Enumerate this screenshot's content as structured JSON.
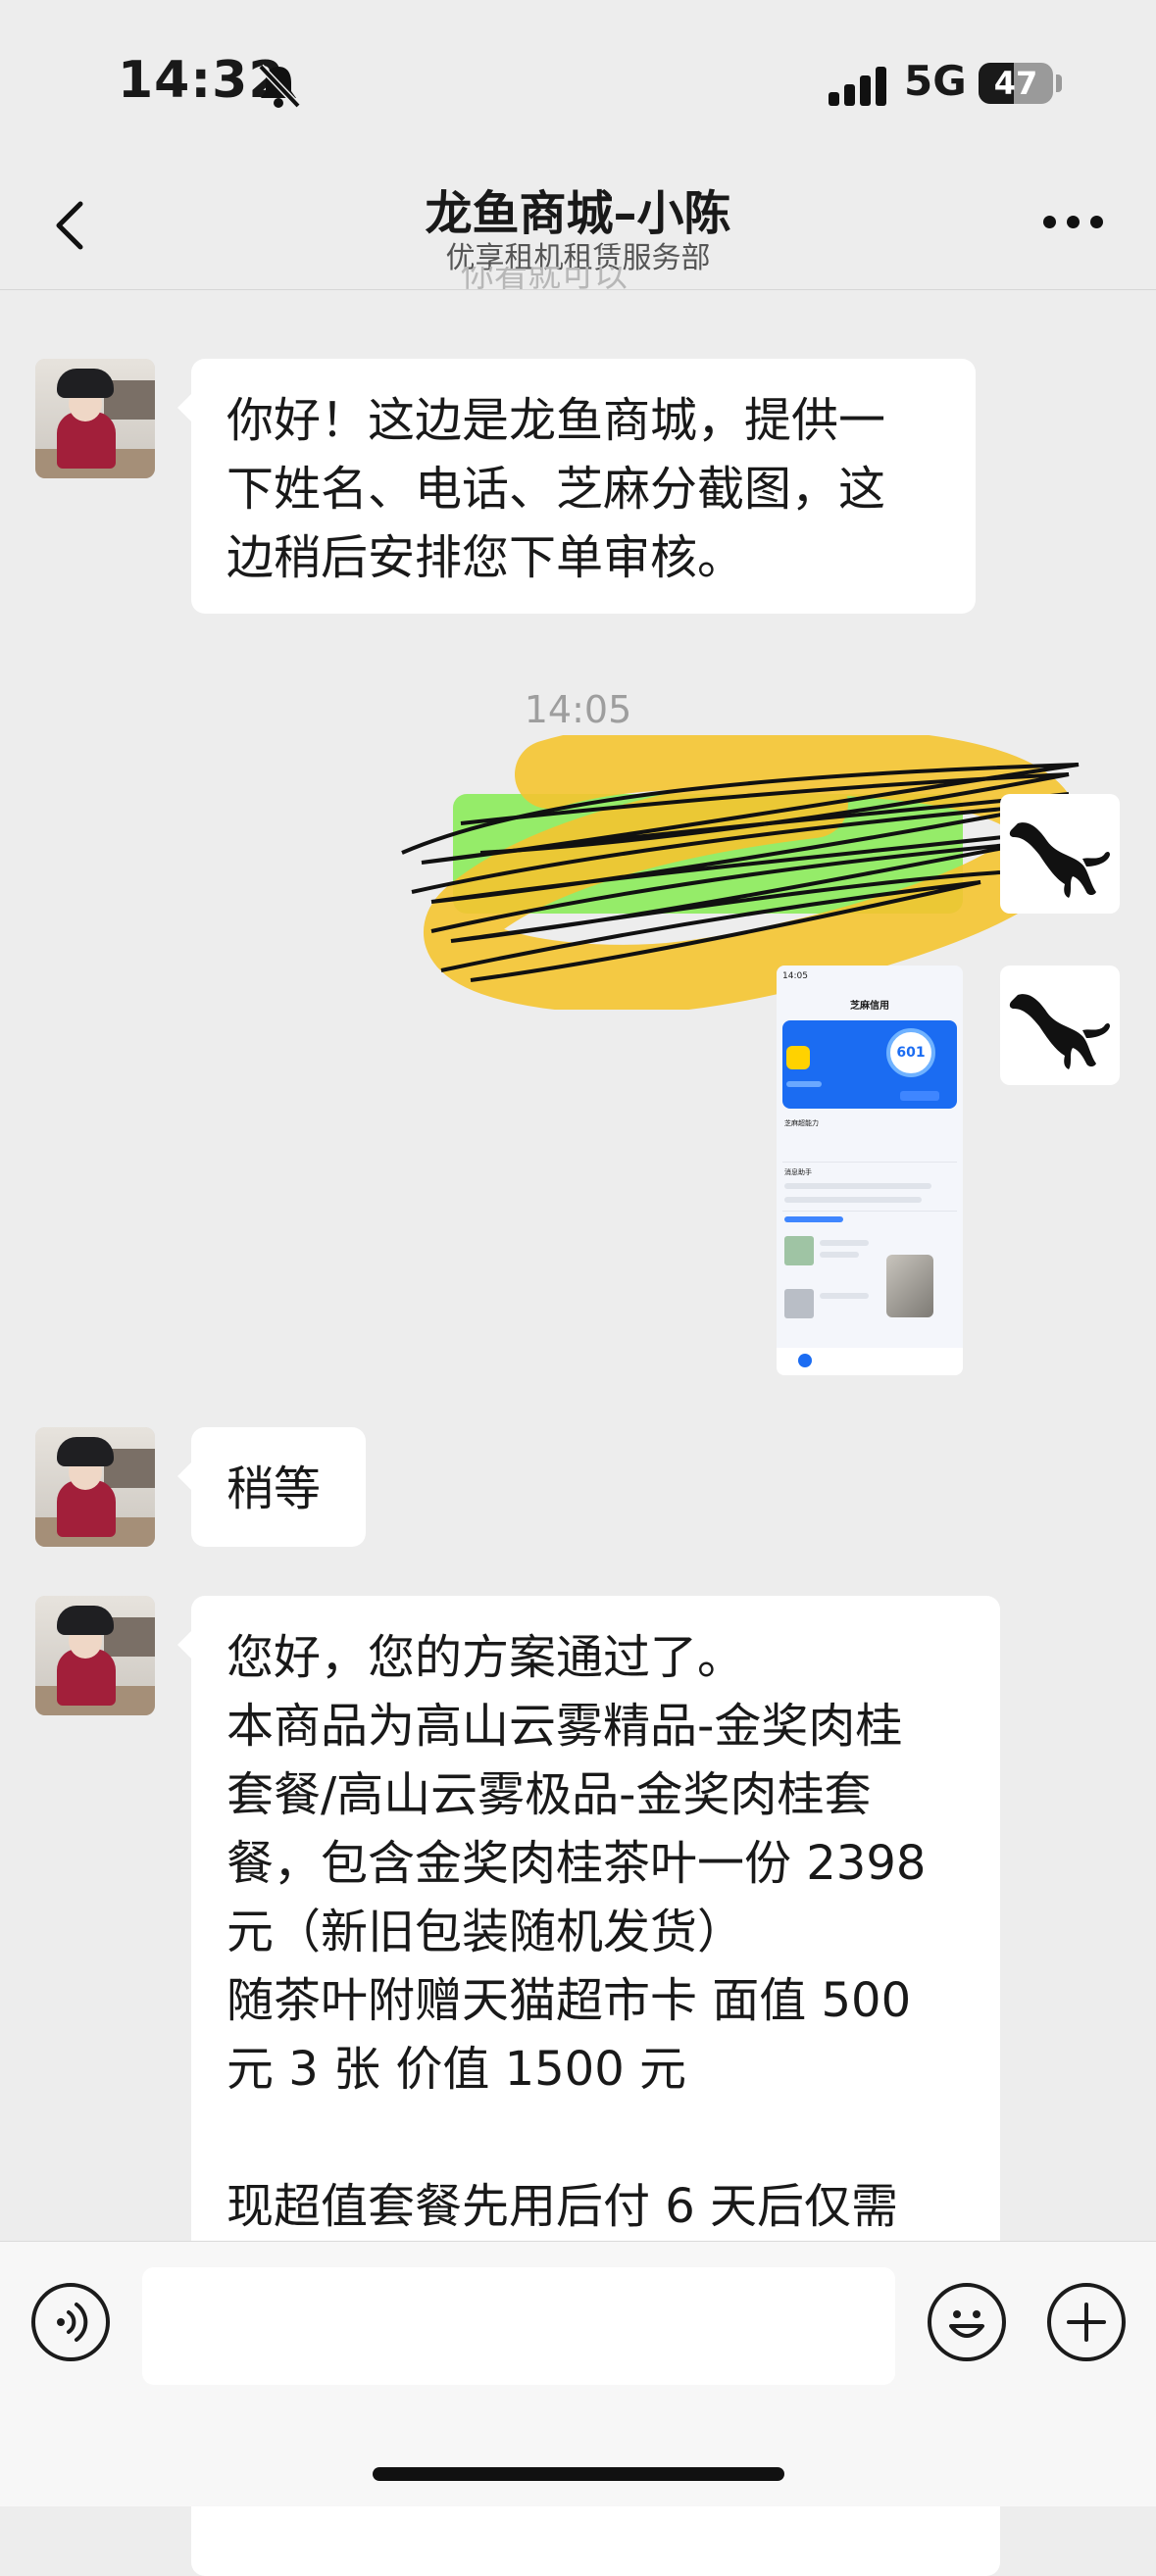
{
  "status_bar": {
    "time": "14:32",
    "network": "5G",
    "battery": "47",
    "battery_level": 0.47
  },
  "nav": {
    "title": "龙鱼商城–小陈",
    "subtitle": "优享租机租赁服务部"
  },
  "messages": {
    "top_cut": "你看就可以",
    "m1": [
      "你好！这边是龙鱼商城，提供一",
      "下姓名、电话、芝麻分截图，这",
      "边稍后安排您下单审核。"
    ],
    "timestamp": "14:05",
    "m2": "稍等",
    "m3": [
      "您好，您的方案通过了。",
      "本商品为高山云雾精品-金奖肉桂",
      "套餐/高山云雾极品-金奖肉桂套",
      "餐，包含金奖肉桂茶叶一份 2398",
      "元（新旧包装随机发货）",
      "随茶叶附赠天猫超市卡 面值 500",
      "元 3 张 价值 1500 元",
      "",
      "现超值套餐先用后付 6 天后仅需"
    ]
  },
  "screenshot_thumb": {
    "time": "14:05",
    "title": "芝麻信用",
    "score": "601",
    "label_capacity": "芝麻超能力",
    "label_assistant": "消息助手"
  },
  "icons": {
    "back": "chevron-left-icon",
    "more": "more-dots-icon",
    "voice": "voice-icon",
    "emoji": "emoji-icon",
    "plus": "plus-icon"
  }
}
